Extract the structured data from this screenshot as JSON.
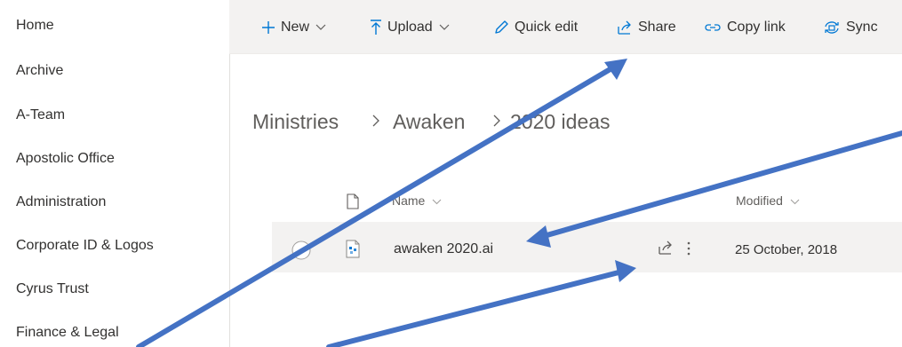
{
  "sidebar": {
    "items": [
      {
        "label": "Home"
      },
      {
        "label": "Archive"
      },
      {
        "label": "A-Team"
      },
      {
        "label": "Apostolic Office"
      },
      {
        "label": "Administration"
      },
      {
        "label": "Corporate ID & Logos"
      },
      {
        "label": "Cyrus Trust"
      },
      {
        "label": "Finance & Legal"
      }
    ]
  },
  "toolbar": {
    "new_label": "New",
    "upload_label": "Upload",
    "quick_edit_label": "Quick edit",
    "share_label": "Share",
    "copy_link_label": "Copy link",
    "sync_label": "Sync"
  },
  "breadcrumb": [
    "Ministries",
    "Awaken",
    "2020 ideas"
  ],
  "table": {
    "columns": {
      "name": "Name",
      "modified": "Modified"
    },
    "rows": [
      {
        "name": "awaken 2020.ai",
        "modified": "25 October, 2018"
      }
    ]
  },
  "colors": {
    "accent": "#0078d4",
    "arrow": "#4472c4",
    "commandbar_bg": "#f3f2f1",
    "selected_row_bg": "#f3f2f1"
  },
  "icons": [
    "plus-icon",
    "upload-icon",
    "pencil-icon",
    "share-icon",
    "link-icon",
    "sync-icon",
    "chevron-down-icon",
    "document-icon",
    "ai-file-icon",
    "more-vertical-icon",
    "radio-circle-icon"
  ]
}
